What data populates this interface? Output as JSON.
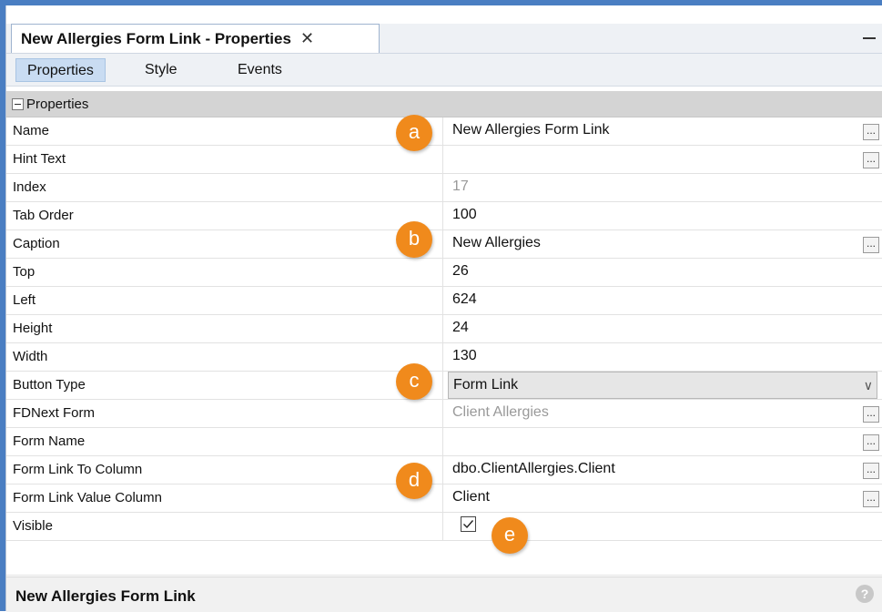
{
  "panel": {
    "title": "New Allergies Form Link - Properties",
    "close_glyph": "✕"
  },
  "tabs": [
    {
      "label": "Properties",
      "active": true
    },
    {
      "label": "Style",
      "active": false
    },
    {
      "label": "Events",
      "active": false
    }
  ],
  "section": {
    "label": "Properties"
  },
  "rows": [
    {
      "name": "Name",
      "value": "New Allergies Form Link",
      "has_ellipsis": true
    },
    {
      "name": "Hint Text",
      "value": "",
      "has_ellipsis": true
    },
    {
      "name": "Index",
      "value": "17",
      "readonly": true
    },
    {
      "name": "Tab Order",
      "value": "100"
    },
    {
      "name": "Caption",
      "value": "New Allergies",
      "has_ellipsis": true
    },
    {
      "name": "Top",
      "value": "26"
    },
    {
      "name": "Left",
      "value": "624"
    },
    {
      "name": "Height",
      "value": "24"
    },
    {
      "name": "Width",
      "value": "130"
    },
    {
      "name": "Button Type",
      "value": "Form Link",
      "type": "select"
    },
    {
      "name": "FDNext Form",
      "value": "Client Allergies",
      "readonly": true,
      "has_ellipsis": true
    },
    {
      "name": "Form Name",
      "value": "",
      "has_ellipsis": true
    },
    {
      "name": "Form Link To Column",
      "value": "dbo.ClientAllergies.Client",
      "has_ellipsis": true
    },
    {
      "name": "Form Link Value Column",
      "value": "Client",
      "has_ellipsis": true
    },
    {
      "name": "Visible",
      "value": "",
      "type": "checkbox",
      "checked": true
    }
  ],
  "ellipsis_label": "...",
  "select_chevron": "∨",
  "footer": {
    "selected_name": "New Allergies Form Link",
    "help_glyph": "?"
  },
  "callouts": [
    "a",
    "b",
    "c",
    "d",
    "e"
  ],
  "colors": {
    "callout": "#f08a1c",
    "active_tab": "#c9dcf2",
    "section_header": "#d4d4d4"
  }
}
